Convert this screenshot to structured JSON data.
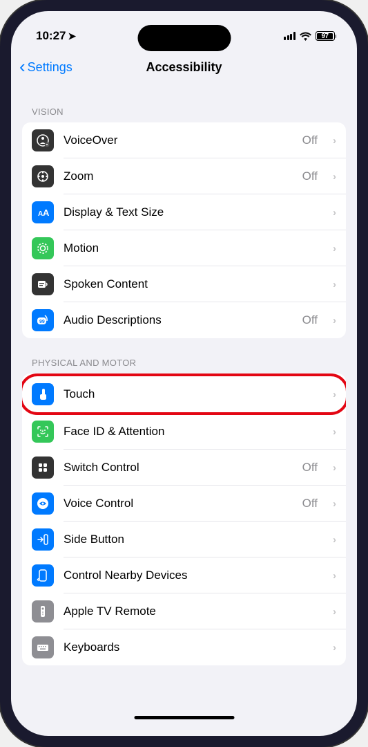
{
  "status": {
    "time": "10:27",
    "battery": "97"
  },
  "nav": {
    "back": "Settings",
    "title": "Accessibility"
  },
  "sections": {
    "vision": {
      "header": "VISION",
      "items": [
        {
          "label": "VoiceOver",
          "value": "Off"
        },
        {
          "label": "Zoom",
          "value": "Off"
        },
        {
          "label": "Display & Text Size",
          "value": ""
        },
        {
          "label": "Motion",
          "value": ""
        },
        {
          "label": "Spoken Content",
          "value": ""
        },
        {
          "label": "Audio Descriptions",
          "value": "Off"
        }
      ]
    },
    "physical": {
      "header": "PHYSICAL AND MOTOR",
      "items": [
        {
          "label": "Touch",
          "value": ""
        },
        {
          "label": "Face ID & Attention",
          "value": ""
        },
        {
          "label": "Switch Control",
          "value": "Off"
        },
        {
          "label": "Voice Control",
          "value": "Off"
        },
        {
          "label": "Side Button",
          "value": ""
        },
        {
          "label": "Control Nearby Devices",
          "value": ""
        },
        {
          "label": "Apple TV Remote",
          "value": ""
        },
        {
          "label": "Keyboards",
          "value": ""
        }
      ]
    }
  }
}
